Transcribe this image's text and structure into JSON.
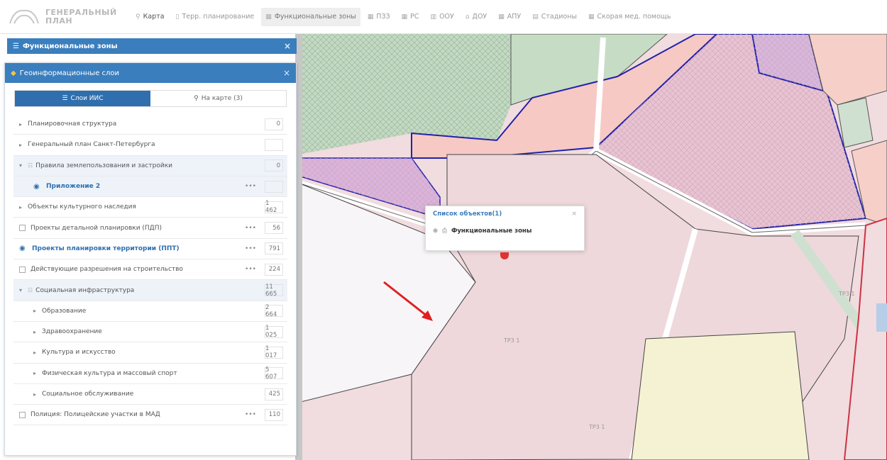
{
  "header": {
    "logo_line1": "ГЕНЕРАЛЬНЫЙ",
    "logo_line2": "ПЛАН",
    "nav": [
      {
        "label": "Карта",
        "icon": "pin-icon",
        "state": "active"
      },
      {
        "label": "Терр. планирование",
        "icon": "doc-icon",
        "state": ""
      },
      {
        "label": "Функциональные зоны",
        "icon": "grid-icon",
        "state": "current"
      },
      {
        "label": "ПЗЗ",
        "icon": "grid-icon",
        "state": ""
      },
      {
        "label": "РС",
        "icon": "grid-icon",
        "state": ""
      },
      {
        "label": "ООУ",
        "icon": "building-icon",
        "state": ""
      },
      {
        "label": "ДОУ",
        "icon": "school-icon",
        "state": ""
      },
      {
        "label": "АПУ",
        "icon": "grid-icon",
        "state": ""
      },
      {
        "label": "Стадионы",
        "icon": "calendar-icon",
        "state": ""
      },
      {
        "label": "Скорая мед. помощь",
        "icon": "grid-icon",
        "state": ""
      }
    ]
  },
  "panel_func": {
    "title": "Функциональные зоны",
    "close": "×"
  },
  "panel_layers": {
    "title": "Геоинформационные слои",
    "close": "×",
    "tabs": [
      {
        "label": "Слои ИИС",
        "active": true
      },
      {
        "label": "На карте (3)",
        "active": false
      }
    ],
    "rows": [
      {
        "label": "Планировочная структура",
        "count": "0",
        "kind": "expand",
        "indent": 0
      },
      {
        "label": "Генеральный план Санкт-Петербурга",
        "count": "",
        "kind": "expand",
        "indent": 0
      },
      {
        "label": "Правила землепользования и застройки",
        "count": "0",
        "kind": "open-sub",
        "indent": 0,
        "bg": true
      },
      {
        "label": "Приложение 2",
        "count": "",
        "kind": "eye",
        "indent": 1,
        "dots": true,
        "bold": true,
        "bg": true
      },
      {
        "label": "Объекты культурного наследия",
        "count": "1 462",
        "kind": "expand",
        "indent": 0
      },
      {
        "label": "Проекты детальной планировки (ПДП)",
        "count": "56",
        "kind": "check",
        "indent": 0,
        "dots": true
      },
      {
        "label": "Проекты планировки территории (ППТ)",
        "count": "791",
        "kind": "eye",
        "indent": 0,
        "dots": true,
        "bold": true
      },
      {
        "label": "Действующие разрешения на строительство",
        "count": "224",
        "kind": "check",
        "indent": 0,
        "dots": true
      },
      {
        "label": "Социальная инфраструктура",
        "count": "11 665",
        "kind": "open-sub",
        "indent": 0,
        "bg": true
      },
      {
        "label": "Образование",
        "count": "2 664",
        "kind": "expand",
        "indent": 1
      },
      {
        "label": "Здравоохранение",
        "count": "1 025",
        "kind": "expand",
        "indent": 1
      },
      {
        "label": "Культура и искусство",
        "count": "1 017",
        "kind": "expand",
        "indent": 1
      },
      {
        "label": "Физическая культура и массовый спорт",
        "count": "5 607",
        "kind": "expand",
        "indent": 1
      },
      {
        "label": "Социальное обслуживание",
        "count": "425",
        "kind": "expand",
        "indent": 1
      },
      {
        "label": "Полиция: Полицейские участки в МАД",
        "count": "110",
        "kind": "check",
        "indent": 0,
        "dots": true
      }
    ]
  },
  "popup": {
    "title": "Список объектов(1)",
    "close": "×",
    "item": "Функциональные зоны"
  },
  "map_labels": [
    {
      "text": "ТР3 1"
    },
    {
      "text": "ТР3 1"
    },
    {
      "text": "ТР3 1"
    }
  ],
  "colors": {
    "accent": "#3a7ebd",
    "zone_border": "#2222aa",
    "annotation": "#e01f1f"
  }
}
